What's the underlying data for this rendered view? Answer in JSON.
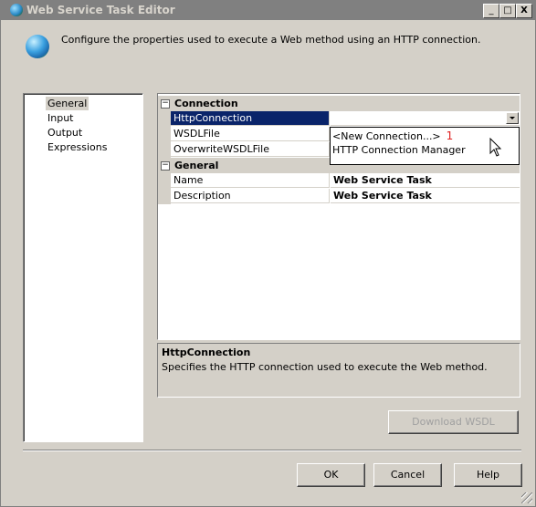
{
  "window": {
    "title": "Web Service Task Editor",
    "minimize": "_",
    "maximize": "□",
    "close": "X"
  },
  "header": {
    "description": "Configure the properties used to execute a Web method using an HTTP connection.",
    "icon": "globe-icon"
  },
  "nav": {
    "items": [
      {
        "label": "General",
        "selected": true
      },
      {
        "label": "Input"
      },
      {
        "label": "Output"
      },
      {
        "label": "Expressions"
      }
    ]
  },
  "grid": {
    "connection": {
      "category": "Connection",
      "toggle": "⊟",
      "rows": [
        {
          "name": "HttpConnection",
          "value": ""
        },
        {
          "name": "WSDLFile",
          "value": ""
        },
        {
          "name": "OverwriteWSDLFile",
          "value": ""
        }
      ]
    },
    "general": {
      "category": "General",
      "toggle": "⊟",
      "rows": [
        {
          "name": "Name",
          "value": "Web Service Task"
        },
        {
          "name": "Description",
          "value": "Web Service Task"
        }
      ]
    }
  },
  "dropdown": {
    "options": [
      "<New Connection...>",
      "HTTP Connection Manager"
    ],
    "badge": "1"
  },
  "help_panel": {
    "title": "HttpConnection",
    "text": "Specifies the HTTP connection used to execute the Web method."
  },
  "buttons": {
    "download_wsdl": "Download WSDL",
    "ok": "OK",
    "cancel": "Cancel",
    "help": "Help"
  },
  "colors": {
    "selection": "#0a246a",
    "badge": "#e02020",
    "face": "#d4d0c8"
  }
}
